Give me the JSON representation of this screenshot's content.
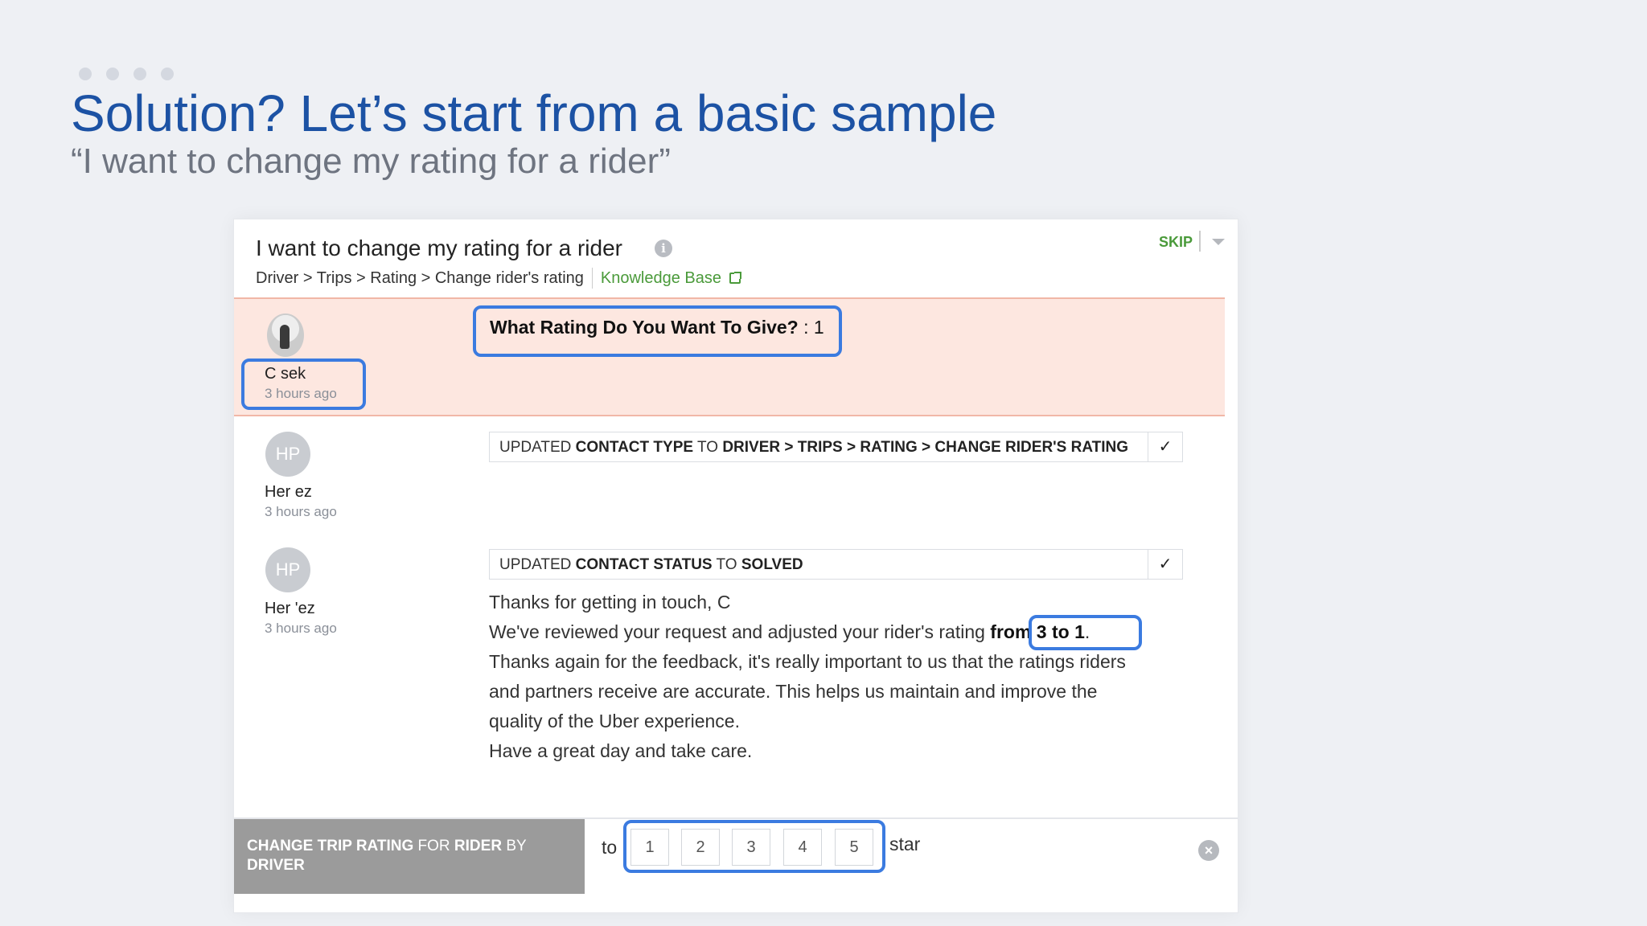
{
  "slide": {
    "title": "Solution? Let’s start from a basic sample",
    "subtitle": "“I want to change my rating for a rider”"
  },
  "panel": {
    "title": "I want to change my rating for a rider",
    "info_icon": "info-icon",
    "breadcrumb": "Driver > Trips > Rating > Change rider's rating",
    "knowledge_base": "Knowledge Base",
    "skip": "SKIP"
  },
  "entry1": {
    "author": "C        sek",
    "time": "3 hours ago",
    "question_label": "What Rating Do You Want To Give?",
    "question_sep": " : ",
    "question_value": "1"
  },
  "entry2": {
    "initials": "HP",
    "author": "Her                        ez",
    "time": "3 hours ago",
    "action_prefix": "UPDATED ",
    "action_field": "CONTACT TYPE",
    "action_to": " TO ",
    "action_value": "DRIVER > TRIPS > RATING > CHANGE RIDER'S RATING"
  },
  "entry3": {
    "initials": "HP",
    "author": "Her                        'ez",
    "time": "3 hours ago",
    "action_prefix": "UPDATED ",
    "action_field": "CONTACT STATUS",
    "action_to": " TO ",
    "action_value": "SOLVED",
    "message": {
      "line1": "Thanks for getting in touch, C",
      "line2_pre": "We've reviewed your request and adjusted your rider's rating ",
      "line2_bold": "from 3 to 1",
      "line2_post": ".",
      "line3": "Thanks again for the feedback, it's really important to us that the ratings riders",
      "line4": "and partners receive are accurate. This helps us maintain and improve the",
      "line5": "quality of the Uber experience.",
      "line6": "Have a great day and take care."
    }
  },
  "footer": {
    "label_bold1": "CHANGE TRIP RATING",
    "label_lite1": " FOR ",
    "label_bold2": "RIDER",
    "label_lite2": " BY",
    "label_bold3": "DRIVER",
    "to": "to",
    "ratings": [
      "1",
      "2",
      "3",
      "4",
      "5"
    ],
    "star": "star"
  },
  "colors": {
    "title_blue": "#1c52a4",
    "highlight_bg": "#fde7e0",
    "outline_blue": "#3b7be0",
    "kb_green": "#4a9a3a"
  }
}
